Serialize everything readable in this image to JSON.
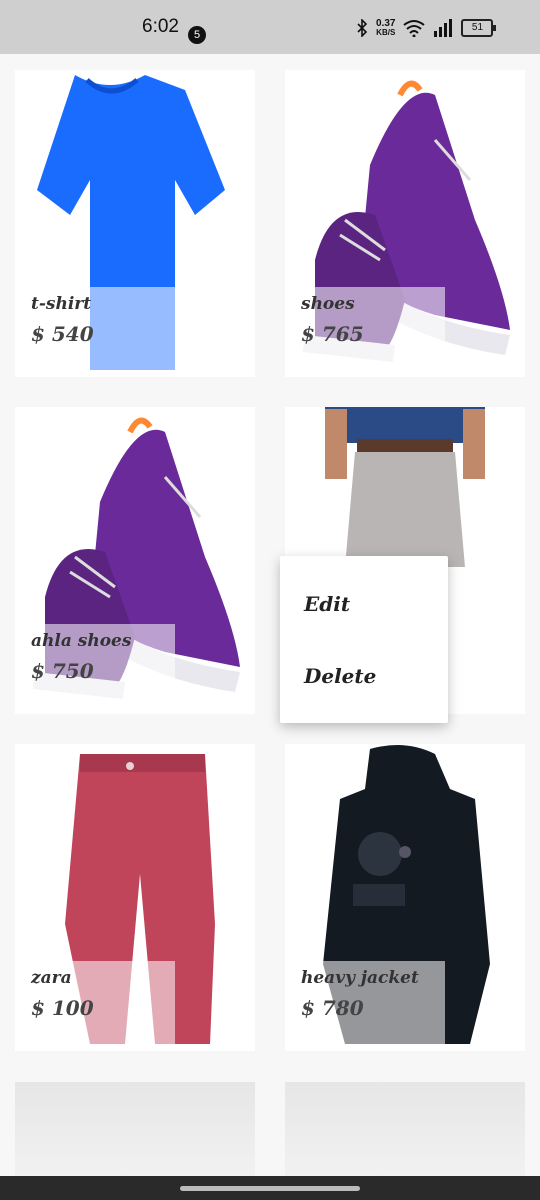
{
  "status_bar": {
    "time": "6:02",
    "notification_count": "5",
    "network_speed": "0.37",
    "network_speed_unit": "KB/S",
    "battery": "51"
  },
  "products": [
    {
      "title": "t-shirt",
      "price": "$ 540",
      "image_icon": "blue-tshirt-image",
      "color": "#1a6cff"
    },
    {
      "title": "shoes",
      "price": "$ 765",
      "image_icon": "purple-sneakers-image",
      "color": "#6a2a9a"
    },
    {
      "title": "ahla shoes",
      "price": "$ 750",
      "image_icon": "purple-sneakers-image",
      "color": "#6a2a9a"
    },
    {
      "title": "",
      "price": "",
      "image_icon": "grey-trousers-image",
      "color": "#b9b5b5"
    },
    {
      "title": "zara",
      "price": "$ 100",
      "image_icon": "red-pants-image",
      "color": "#c0455b"
    },
    {
      "title": "heavy jacket",
      "price": "$ 780",
      "image_icon": "black-jacket-image",
      "color": "#141a22"
    }
  ],
  "context_menu": {
    "edit_label": "Edit",
    "delete_label": "Delete"
  }
}
